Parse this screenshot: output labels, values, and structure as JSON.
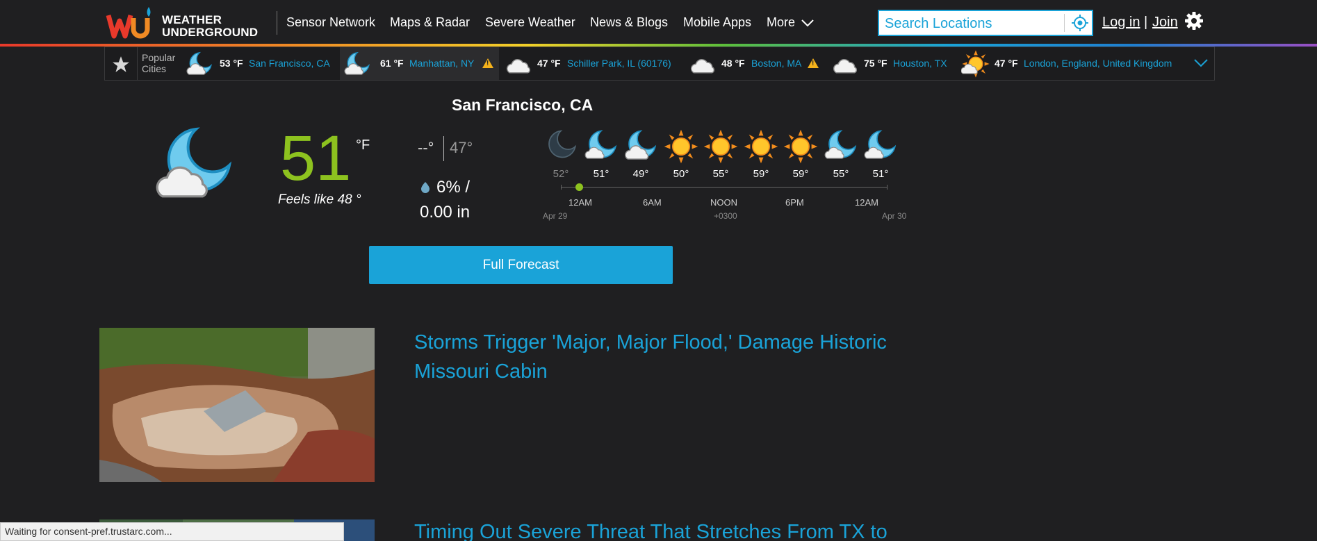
{
  "header": {
    "logo_line1": "WEATHER",
    "logo_line2": "UNDERGROUND",
    "nav": [
      "Sensor Network",
      "Maps & Radar",
      "Severe Weather",
      "News & Blogs",
      "Mobile Apps",
      "More"
    ],
    "search_placeholder": "Search Locations",
    "login": "Log in",
    "separator": "|",
    "join": "Join"
  },
  "popular": {
    "label_line1": "Popular",
    "label_line2": "Cities",
    "cities": [
      {
        "temp": "53 °F",
        "name": "San Francisco, CA",
        "icon": "moon-cloud-icon"
      },
      {
        "temp": "61 °F",
        "name": "Manhattan, NY",
        "icon": "moon-cloud-icon",
        "alert": true
      },
      {
        "temp": "47 °F",
        "name": "Schiller Park, IL (60176)",
        "icon": "cloud-icon"
      },
      {
        "temp": "48 °F",
        "name": "Boston, MA",
        "icon": "cloud-icon",
        "alert": true
      },
      {
        "temp": "75 °F",
        "name": "Houston, TX",
        "icon": "cloud-icon"
      },
      {
        "temp": "47 °F",
        "name": "London, England, United Kingdom",
        "icon": "sun-cloud-icon"
      }
    ]
  },
  "current": {
    "location": "San Francisco, CA",
    "temp": "51",
    "unit": "°F",
    "feels_like": "Feels like 48 °",
    "high": "--°",
    "low": "47°",
    "precip_pct": "6% /",
    "precip_amount": "0.00 in"
  },
  "hourly": {
    "temps": [
      "52°",
      "51°",
      "49°",
      "50°",
      "55°",
      "59°",
      "59°",
      "55°",
      "51°"
    ],
    "icons": [
      "moon-icon",
      "moon-cloud-icon",
      "moon-cloud-icon",
      "sun-icon",
      "sun-icon",
      "sun-icon",
      "sun-icon",
      "moon-cloud-icon",
      "moon-cloud-icon"
    ],
    "ticks": [
      "12AM",
      "6AM",
      "NOON",
      "6PM",
      "12AM"
    ],
    "date_start": "Apr 29",
    "tz": "+0300",
    "date_end": "Apr 30"
  },
  "full_forecast": "Full Forecast",
  "news": [
    {
      "headline_line1": "Storms Trigger 'Major, Major Flood,' Damage Historic",
      "headline_line2": "Missouri Cabin"
    },
    {
      "headline_line1": "Timing Out Severe Threat That Stretches From TX to"
    }
  ],
  "status_text": "Waiting for consent-pref.trustarc.com...",
  "colors": {
    "accent": "#1aa3d8",
    "temp_green": "#8dc21f",
    "background": "#1f1f21"
  }
}
